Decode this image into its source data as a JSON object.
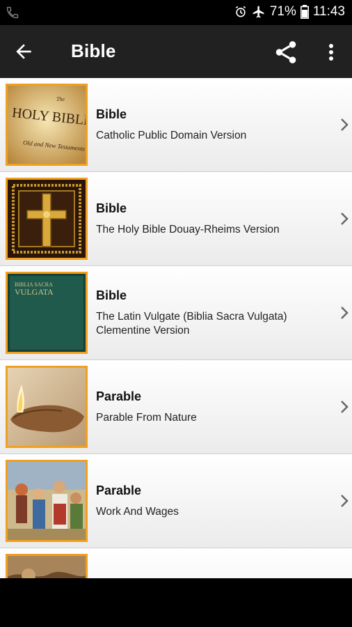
{
  "status": {
    "battery": "71%",
    "time": "11:43"
  },
  "appbar": {
    "title": "Bible"
  },
  "items": [
    {
      "title": "Bible",
      "subtitle": "Catholic Public Domain Version",
      "thumb_text_1": "The",
      "thumb_text_2": "HOLY BIBLE",
      "thumb_text_3": "Old and New Testaments"
    },
    {
      "title": "Bible",
      "subtitle": "The Holy Bible Douay-Rheims Version"
    },
    {
      "title": "Bible",
      "subtitle": "The Latin Vulgate (Biblia Sacra Vulgata) Clementine Version",
      "thumb_text_1": "BIBLIA SACRA",
      "thumb_text_2": "VULGATA"
    },
    {
      "title": "Parable",
      "subtitle": "Parable From Nature"
    },
    {
      "title": "Parable",
      "subtitle": "Work And Wages"
    },
    {
      "title": "",
      "subtitle": ""
    }
  ],
  "colors": {
    "appbar": "#212121",
    "thumb_border": "#f0a020"
  }
}
